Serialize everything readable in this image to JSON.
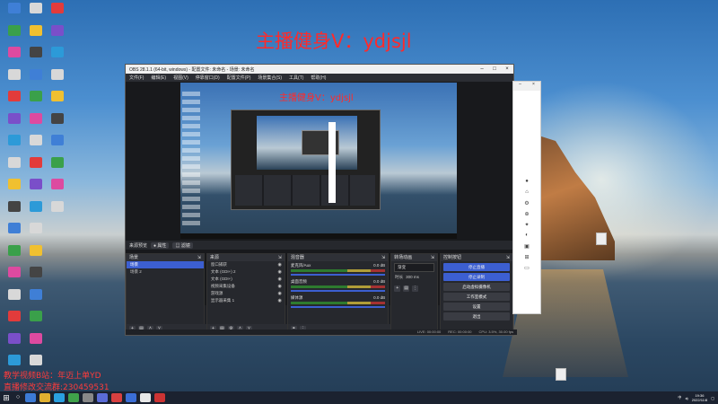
{
  "desktop": {
    "overlay_title": "主播健身V：ydjsjl",
    "watermark_line1": "教学视频B站：年迈上单YD",
    "watermark_line2": "直播修改交流群:230459531",
    "right_icons": [
      {
        "label": "",
        "icon": "file-icon"
      },
      {
        "label": "",
        "icon": "file-icon"
      }
    ],
    "left_icon_colors": [
      "#3f7fd6",
      "#d8d8d8",
      "#e23b3b",
      "#3aa04a",
      "#f0c030",
      "#7a4fc9",
      "#dd4aa0",
      "#444444",
      "#2c9ad8",
      "#d8d8d8"
    ]
  },
  "obs": {
    "title": "OBS 28.1.1 (64-bit, windows) - 配置文件: 未命名 - 场景: 未命名",
    "menu": [
      "文件(F)",
      "编辑(E)",
      "视图(V)",
      "停靠窗口(D)",
      "配置文件(P)",
      "场景集合(S)",
      "工具(T)",
      "帮助(H)"
    ],
    "preview_title": "主播健身V：ydjsjl",
    "scene_bar": {
      "label": "来源预览",
      "pill1": "● 属性",
      "pill2": "▤ 滤镜"
    },
    "docks": {
      "scenes": {
        "title": "场景",
        "items": [
          "场景",
          "场景 2"
        ]
      },
      "sources": {
        "title": "来源",
        "items": [
          "窗口捕获",
          "文本 (GDI+) 2",
          "文本 (GDI+)",
          "视频采集设备",
          "游戏源",
          "显示器采集 1"
        ]
      },
      "mixer": {
        "title": "混音器",
        "channels": [
          {
            "name": "麦克风/Aux",
            "db": "0.0 dB"
          },
          {
            "name": "桌面音频",
            "db": "0.0 dB"
          },
          {
            "name": "媒体源",
            "db": "0.0 dB"
          }
        ]
      },
      "transitions": {
        "title": "转场动画",
        "type": "渐变",
        "duration_label": "时长",
        "duration": "300 ms"
      },
      "controls": {
        "title": "控制按钮",
        "buttons": [
          "停止直播",
          "停止录制",
          "启动虚拟摄像机",
          "工作室模式",
          "设置",
          "退出"
        ]
      }
    },
    "status": {
      "live": "LIVE: 00:00:00",
      "rec": "REC: 00:00:00",
      "cpu": "CPU: 3.5%, 30.00 fps"
    }
  },
  "taskbar": {
    "time": "19:36",
    "date": "2022/11/8",
    "app_colors": [
      "#3c7bd6",
      "#e0b030",
      "#2aa0e0",
      "#3fa24a",
      "#888888",
      "#5a6cd8",
      "#d84040",
      "#3b6ed6",
      "#e8e8e8",
      "#cc3333"
    ]
  }
}
